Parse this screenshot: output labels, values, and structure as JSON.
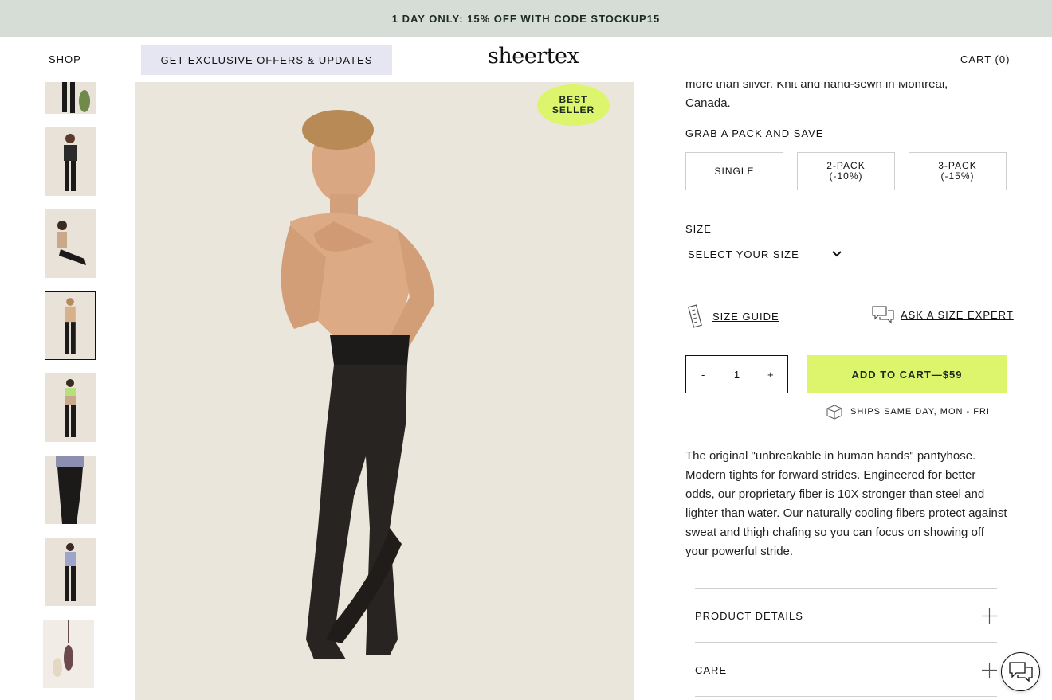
{
  "promo": {
    "text": "1 DAY ONLY: 15% OFF WITH CODE STOCKUP15"
  },
  "header": {
    "shop": "SHOP",
    "offers": "GET EXCLUSIVE OFFERS & UPDATES",
    "logo": "sheertex",
    "cart": "CART (0)"
  },
  "badge": {
    "line1": "BEST",
    "line2": "SELLER"
  },
  "product": {
    "desc_top": "more than silver. Knit and hand-sewn in Montreal, Canada.",
    "pack_title": "GRAB A PACK AND SAVE",
    "packs": [
      {
        "label": "SINGLE",
        "discount": ""
      },
      {
        "label": "2-PACK",
        "discount": "(-10%)"
      },
      {
        "label": "3-PACK",
        "discount": "(-15%)"
      }
    ],
    "size_label": "SIZE",
    "size_placeholder": "SELECT YOUR SIZE",
    "size_guide": "SIZE GUIDE",
    "size_expert": "ASK A SIZE EXPERT",
    "qty_minus": "-",
    "qty_value": "1",
    "qty_plus": "+",
    "add_to_cart": "ADD TO CART—$59",
    "ships": "SHIPS SAME DAY, MON - FRI",
    "description": "The original \"unbreakable in human hands\" pantyhose. Modern tights for forward strides. Engineered for better odds, our proprietary fiber is 10X stronger than steel and lighter than water. Our naturally cooling fibers protect against sweat and thigh chafing so you can focus on showing off your powerful stride."
  },
  "accordion": [
    {
      "label": "PRODUCT DETAILS"
    },
    {
      "label": "CARE"
    }
  ],
  "colors": {
    "promo_bg": "#d6ddd7",
    "offers_bg": "#e6e6f3",
    "accent": "#dcf56c"
  },
  "icons": [
    "ruler-icon",
    "chat-bubbles-icon",
    "box-icon",
    "plus-icon",
    "chevron-down-icon",
    "chat-icon"
  ]
}
